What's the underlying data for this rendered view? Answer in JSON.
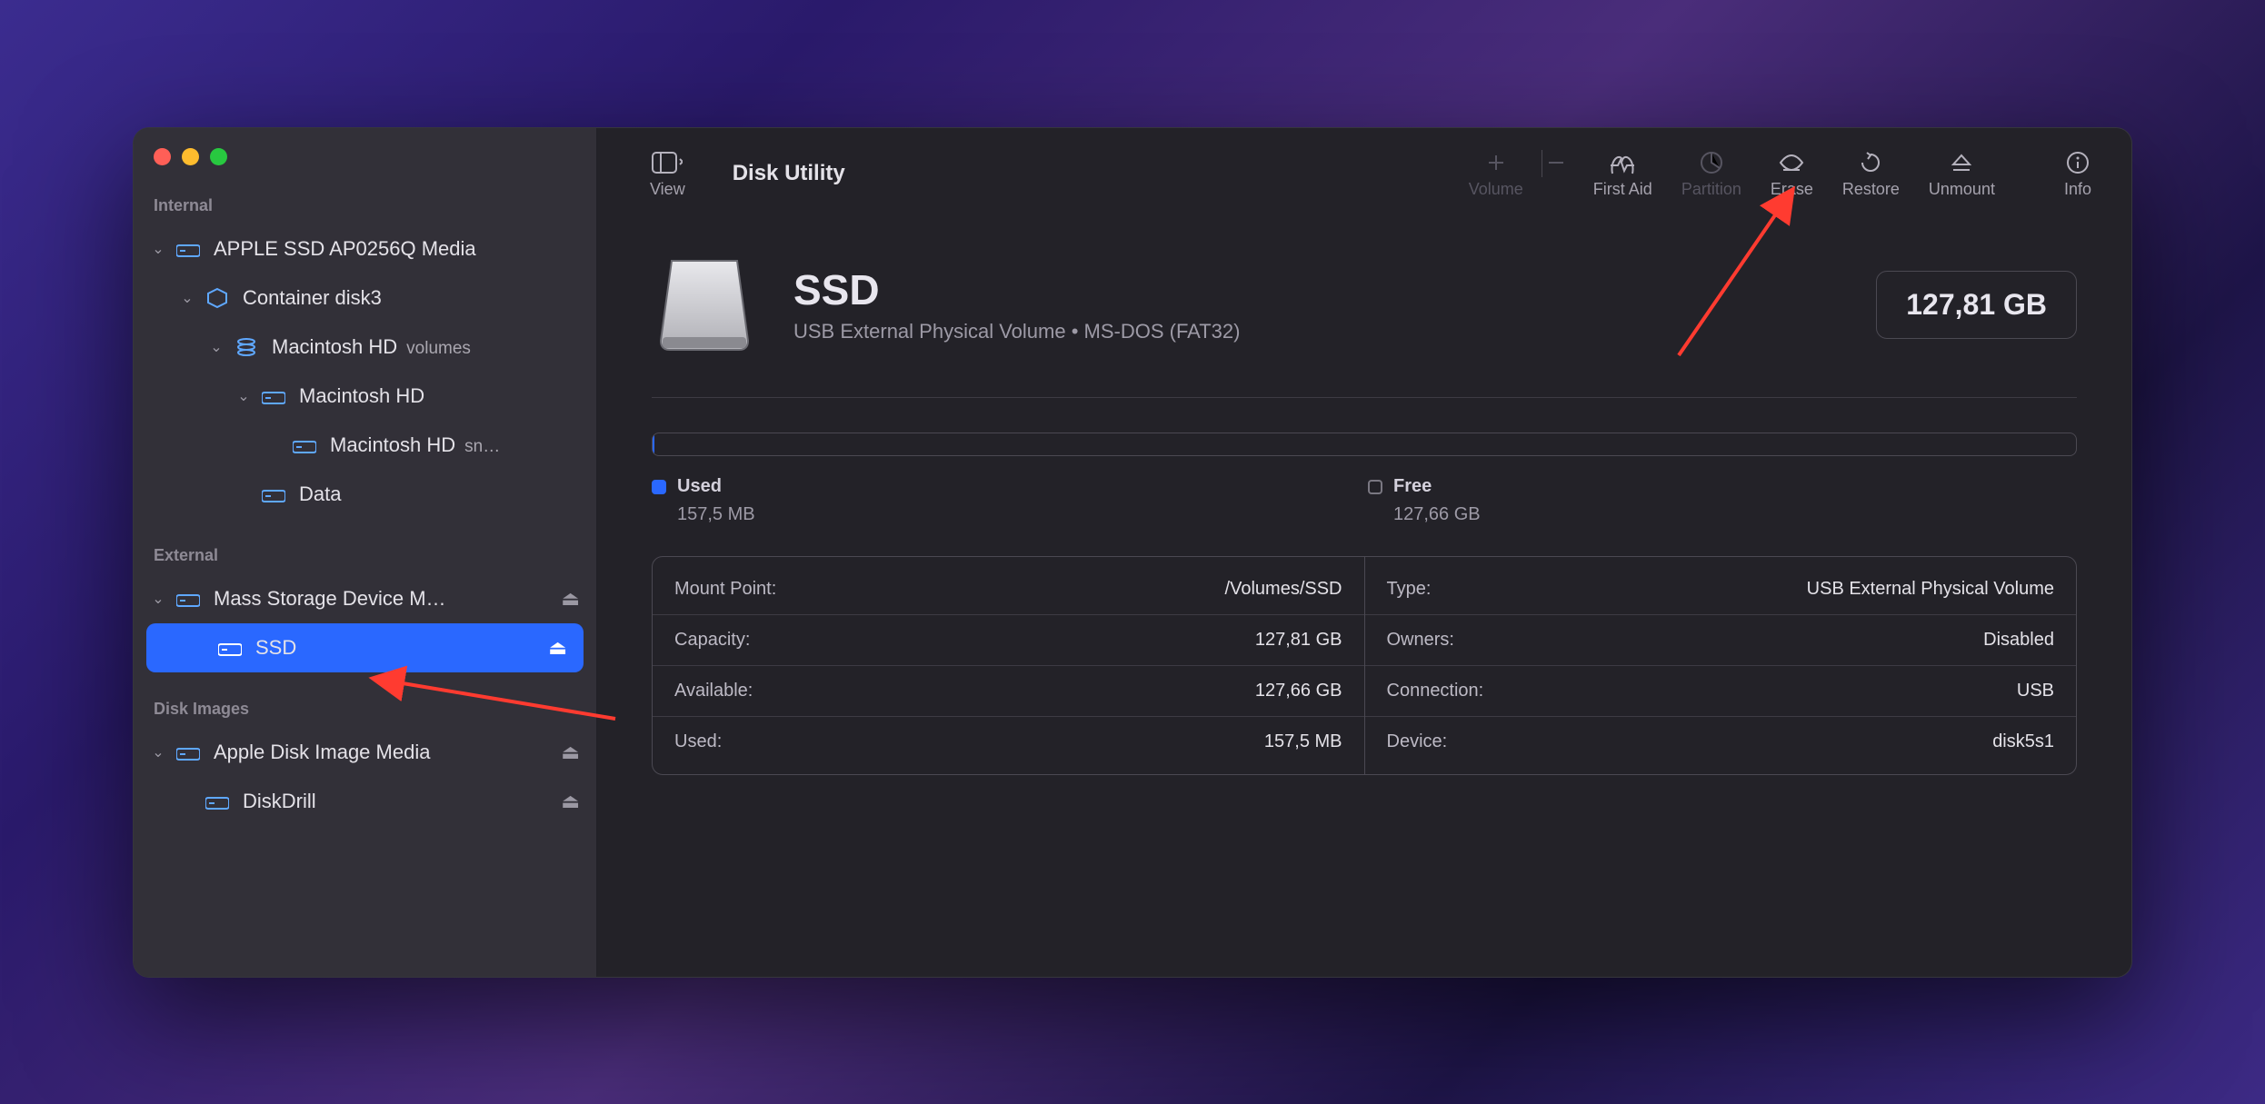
{
  "app_title": "Disk Utility",
  "toolbar": {
    "view_label": "View",
    "volume_label": "Volume",
    "first_aid_label": "First Aid",
    "partition_label": "Partition",
    "erase_label": "Erase",
    "restore_label": "Restore",
    "unmount_label": "Unmount",
    "info_label": "Info"
  },
  "sidebar": {
    "internal_header": "Internal",
    "external_header": "External",
    "disk_images_header": "Disk Images",
    "internal": [
      {
        "label": "APPLE SSD AP0256Q Media",
        "indent": 0,
        "has_children": true,
        "icon": "drive"
      },
      {
        "label": "Container disk3",
        "indent": 1,
        "has_children": true,
        "icon": "container"
      },
      {
        "label": "Macintosh HD",
        "suffix": "volumes",
        "indent": 2,
        "has_children": true,
        "icon": "stack"
      },
      {
        "label": "Macintosh HD",
        "indent": 3,
        "has_children": true,
        "icon": "drive"
      },
      {
        "label": "Macintosh HD",
        "suffix": "sn…",
        "indent": 4,
        "has_children": false,
        "icon": "drive"
      },
      {
        "label": "Data",
        "indent": 3,
        "has_children": false,
        "icon": "drive"
      }
    ],
    "external": [
      {
        "label": "Mass Storage Device M…",
        "indent": 0,
        "has_children": true,
        "icon": "drive",
        "eject": true
      },
      {
        "label": "SSD",
        "indent": 1,
        "has_children": false,
        "icon": "drive",
        "eject": true,
        "selected": true
      }
    ],
    "disk_images": [
      {
        "label": "Apple Disk Image Media",
        "indent": 0,
        "has_children": true,
        "icon": "drive",
        "eject": true
      },
      {
        "label": "DiskDrill",
        "indent": 1,
        "has_children": false,
        "icon": "drive",
        "eject": true
      }
    ]
  },
  "hero": {
    "title": "SSD",
    "subtitle": "USB External Physical Volume • MS-DOS (FAT32)",
    "size": "127,81 GB"
  },
  "usage": {
    "used_label": "Used",
    "used_value": "157,5 MB",
    "free_label": "Free",
    "free_value": "127,66 GB"
  },
  "info": {
    "left": [
      {
        "k": "Mount Point:",
        "v": "/Volumes/SSD"
      },
      {
        "k": "Capacity:",
        "v": "127,81 GB"
      },
      {
        "k": "Available:",
        "v": "127,66 GB"
      },
      {
        "k": "Used:",
        "v": "157,5 MB"
      }
    ],
    "right": [
      {
        "k": "Type:",
        "v": "USB External Physical Volume"
      },
      {
        "k": "Owners:",
        "v": "Disabled"
      },
      {
        "k": "Connection:",
        "v": "USB"
      },
      {
        "k": "Device:",
        "v": "disk5s1"
      }
    ]
  },
  "colors": {
    "accent": "#2a68ff"
  }
}
